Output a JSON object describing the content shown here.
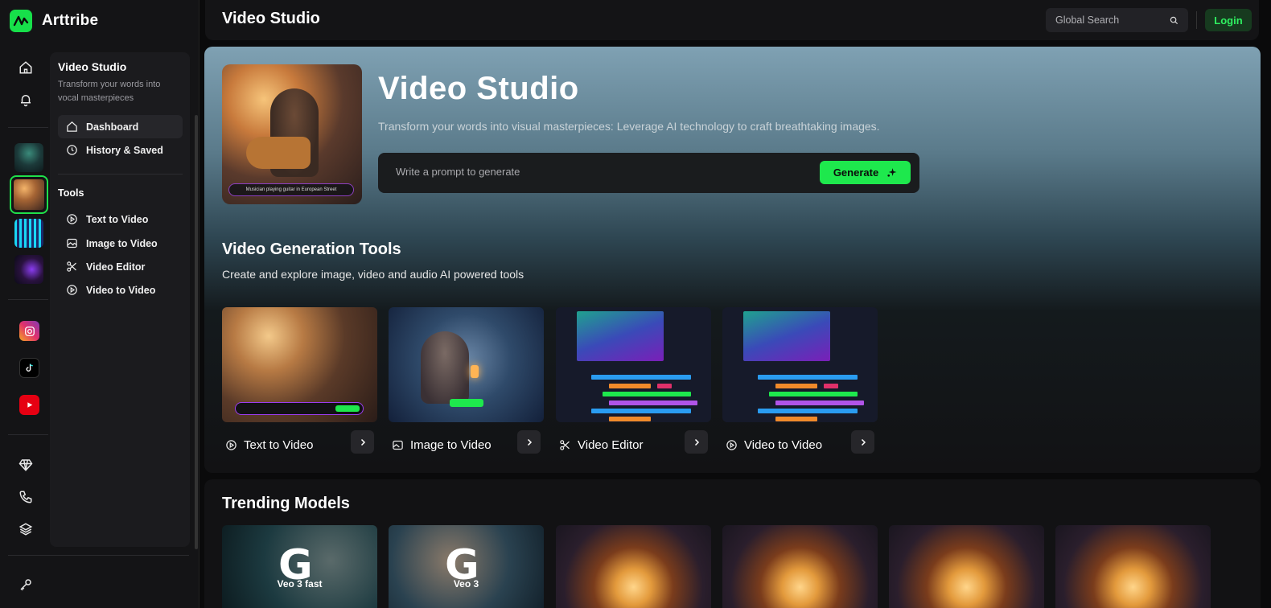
{
  "app": {
    "name": "Arttribe"
  },
  "topbar": {
    "title": "Video Studio",
    "search_placeholder": "Global Search",
    "login_label": "Login"
  },
  "panel": {
    "title": "Video Studio",
    "description": "Transform your words into vocal masterpieces",
    "nav": [
      {
        "label": "Dashboard",
        "icon": "home-icon"
      },
      {
        "label": "History & Saved",
        "icon": "clock-icon"
      }
    ],
    "tools_heading": "Tools",
    "tools": [
      {
        "label": "Text to Video",
        "icon": "play-circle-icon"
      },
      {
        "label": "Image to Video",
        "icon": "image-icon"
      },
      {
        "label": "Video Editor",
        "icon": "scissors-icon"
      },
      {
        "label": "Video to Video",
        "icon": "play-circle-icon"
      }
    ]
  },
  "hero": {
    "title": "Video Studio",
    "subtitle": "Transform your words into visual masterpieces: Leverage AI technology to craft breathtaking images.",
    "prompt_placeholder": "Write a prompt to generate",
    "generate_label": "Generate",
    "image_caption": "Musician playing guitar in European Street"
  },
  "tools_section": {
    "title": "Video Generation Tools",
    "subtitle": "Create and explore image, video and audio AI powered tools",
    "cards": [
      {
        "label": "Text to Video",
        "icon": "play-circle-icon"
      },
      {
        "label": "Image to Video",
        "icon": "image-icon"
      },
      {
        "label": "Video Editor",
        "icon": "scissors-icon"
      },
      {
        "label": "Video to Video",
        "icon": "play-circle-icon"
      }
    ]
  },
  "trending": {
    "title": "Trending Models",
    "models": [
      {
        "label": "Veo 3 fast"
      },
      {
        "label": "Veo 3"
      },
      {
        "label": ""
      },
      {
        "label": ""
      },
      {
        "label": ""
      },
      {
        "label": ""
      }
    ]
  },
  "colors": {
    "accent": "#1ee84d",
    "background": "#0a0a0b",
    "panel": "#1b1b1e"
  }
}
